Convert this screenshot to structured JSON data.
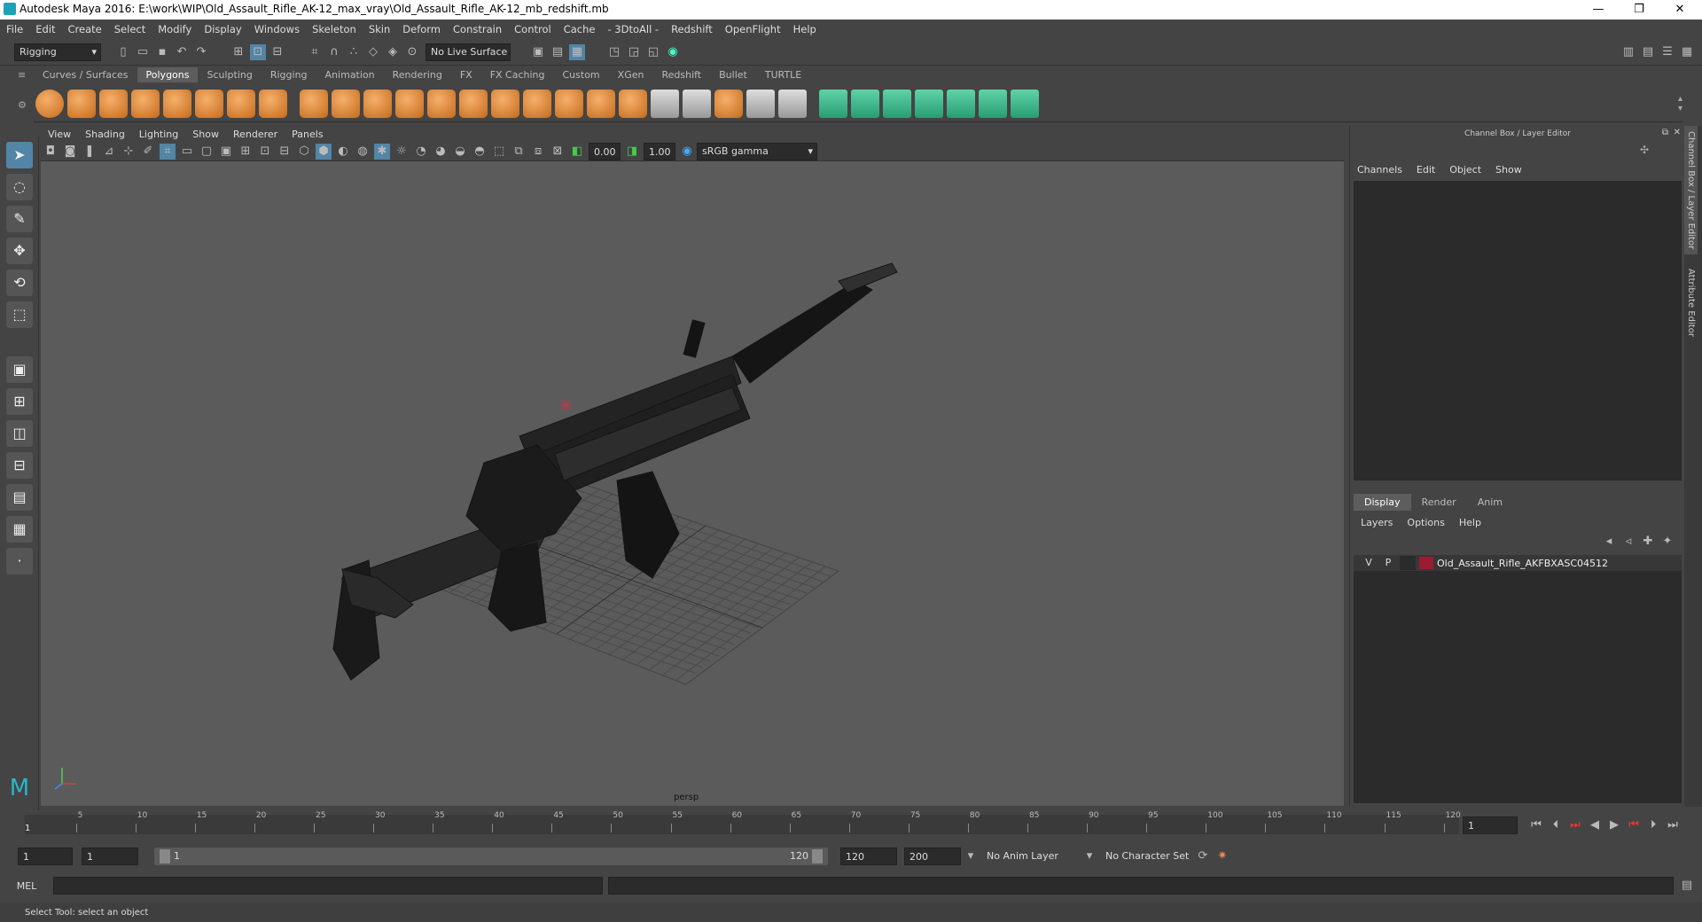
{
  "window": {
    "title": "Autodesk Maya 2016: E:\\work\\WIP\\Old_Assault_Rifle_AK-12_max_vray\\Old_Assault_Rifle_AK-12_mb_redshift.mb",
    "minimize": "—",
    "restore": "❐",
    "close": "✕"
  },
  "menubar": [
    "File",
    "Edit",
    "Create",
    "Select",
    "Modify",
    "Display",
    "Windows",
    "Skeleton",
    "Skin",
    "Deform",
    "Constrain",
    "Control",
    "Cache",
    "- 3DtoAll -",
    "Redshift",
    "OpenFlight",
    "Help"
  ],
  "statusline": {
    "mode": "Rigging",
    "live_surface": "No Live Surface"
  },
  "shelf": {
    "tabs": [
      "Curves / Surfaces",
      "Polygons",
      "Sculpting",
      "Rigging",
      "Animation",
      "Rendering",
      "FX",
      "FX Caching",
      "Custom",
      "XGen",
      "Redshift",
      "Bullet",
      "TURTLE"
    ],
    "active_tab": "Polygons"
  },
  "viewport": {
    "menu": [
      "View",
      "Shading",
      "Lighting",
      "Show",
      "Renderer",
      "Panels"
    ],
    "exposure": "0.00",
    "gamma": "1.00",
    "colorspace": "sRGB gamma",
    "camera": "persp"
  },
  "channel_box": {
    "header": "Channel Box / Layer Editor",
    "menu": [
      "Channels",
      "Edit",
      "Object",
      "Show"
    ]
  },
  "layer_editor": {
    "tabs": [
      "Display",
      "Render",
      "Anim"
    ],
    "active_tab": "Display",
    "menu": [
      "Layers",
      "Options",
      "Help"
    ],
    "layers": [
      {
        "v": "V",
        "p": "P",
        "name": "Old_Assault_Rifle_AKFBXASC04512",
        "color": "#9b1b30"
      }
    ]
  },
  "side_tabs": [
    "Channel Box / Layer Editor",
    "Attribute Editor"
  ],
  "time_slider": {
    "labels": [
      "5",
      "10",
      "15",
      "20",
      "25",
      "30",
      "35",
      "40",
      "45",
      "50",
      "55",
      "60",
      "65",
      "70",
      "75",
      "80",
      "85",
      "90",
      "95",
      "100",
      "105",
      "110",
      "115",
      "120"
    ],
    "start_marker": "1",
    "current_frame": "1"
  },
  "range": {
    "start": "1",
    "playback_start": "1",
    "slider_start": "1",
    "slider_end": "120",
    "playback_end": "120",
    "end": "200",
    "anim_layer": "No Anim Layer",
    "character_set": "No Character Set"
  },
  "cmdline": {
    "label": "MEL"
  },
  "helpline": {
    "text": "Select Tool: select an object"
  }
}
